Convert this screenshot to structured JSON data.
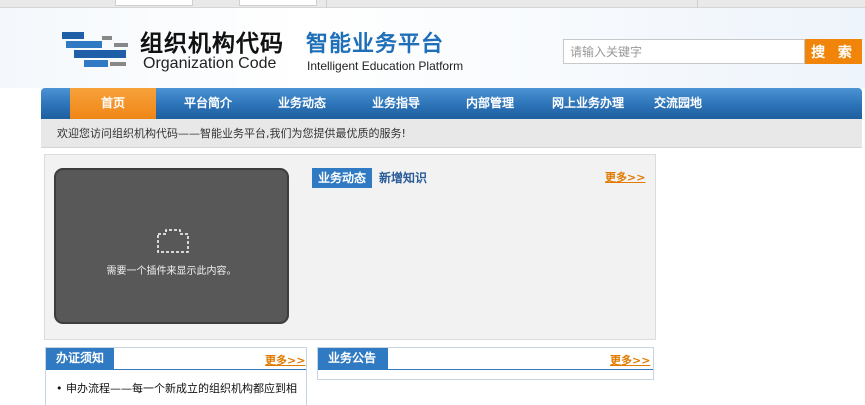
{
  "header": {
    "logo_cn": "组织机构代码",
    "logo_en": "Organization Code",
    "platform_cn": "智能业务平台",
    "platform_en": "Intelligent Education Platform"
  },
  "search": {
    "placeholder": "请输入关键字",
    "button_label": "搜 索"
  },
  "nav": {
    "items": [
      {
        "label": "首页",
        "active": true
      },
      {
        "label": "平台简介"
      },
      {
        "label": "业务动态"
      },
      {
        "label": "业务指导"
      },
      {
        "label": "内部管理"
      },
      {
        "label": "网上业务办理"
      },
      {
        "label": "交流园地"
      }
    ]
  },
  "welcome_text": "欢迎您访问组织机构代码——智能业务平台,我们为您提供最优质的服务!",
  "plugin": {
    "message": "需要一个插件来显示此内容。"
  },
  "news": {
    "tab_active": "业务动态",
    "tab_other": "新增知识",
    "more": "更多>>"
  },
  "notice_panel": {
    "title": "办证须知",
    "more": "更多>>",
    "items": [
      "申办流程——每一个新成立的组织机构都应到相"
    ]
  },
  "announce_panel": {
    "title": "业务公告",
    "more": "更多>>"
  },
  "colors": {
    "nav_blue": "#2c73b8",
    "accent_orange": "#f0850a",
    "panel_blue": "#2f7ac2"
  }
}
